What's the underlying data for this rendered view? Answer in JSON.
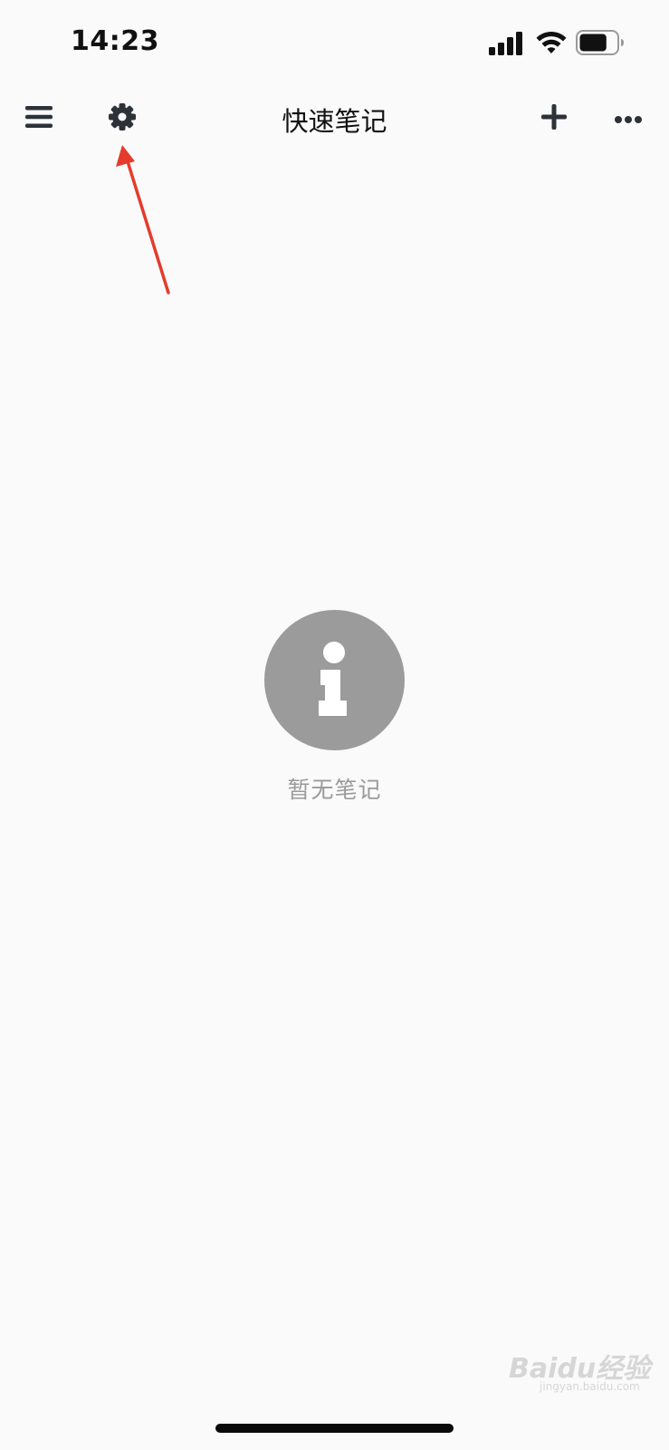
{
  "status_bar": {
    "time": "14:23",
    "signal_icon": "cellular-signal-icon",
    "wifi_icon": "wifi-icon",
    "battery_icon": "battery-icon",
    "battery_level": 0.75
  },
  "nav": {
    "title": "快速笔记",
    "menu_icon": "hamburger-menu-icon",
    "settings_icon": "gear-icon",
    "add_icon": "plus-icon",
    "more_icon": "ellipsis-icon"
  },
  "annotation": {
    "color": "#e53b2c",
    "points_to": "settings-button"
  },
  "empty_state": {
    "icon": "info-icon",
    "icon_color": "#9b9b9b",
    "message": "暂无笔记"
  },
  "watermark": {
    "brand": "Baidu经验",
    "url": "jingyan.baidu.com"
  },
  "colors": {
    "background": "#fafafa",
    "nav_icon": "#2d3238",
    "text_primary": "#111111",
    "text_secondary": "#9a9a9a"
  }
}
